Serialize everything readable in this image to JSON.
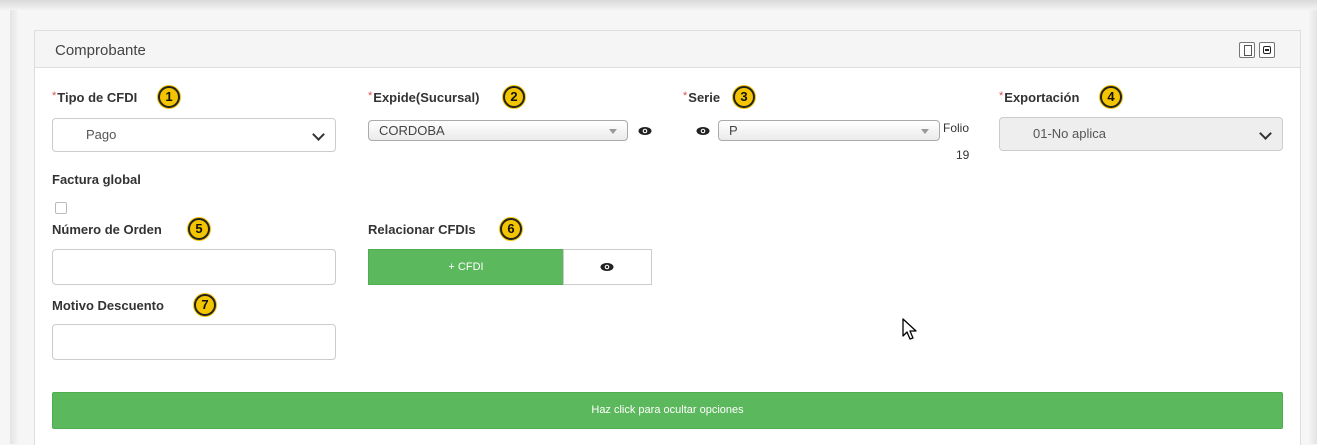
{
  "panel": {
    "title": "Comprobante"
  },
  "fields": {
    "tipo_cfdi": {
      "required_mark": "*",
      "label": "Tipo de CFDI",
      "badge": "1",
      "value": "Pago"
    },
    "expide": {
      "required_mark": "*",
      "label": "Expide(Sucursal)",
      "badge": "2",
      "value": "CORDOBA"
    },
    "serie": {
      "required_mark": "*",
      "label": "Serie",
      "badge": "3",
      "value": "P"
    },
    "folio": {
      "label": "Folio",
      "value": "19"
    },
    "exportacion": {
      "required_mark": "*",
      "label": "Exportación",
      "badge": "4",
      "value": "01-No aplica"
    },
    "factura_global": {
      "label": "Factura global",
      "checked": false
    },
    "numero_orden": {
      "label": "Número de Orden",
      "badge": "5",
      "value": ""
    },
    "relacionar": {
      "label": "Relacionar CFDIs",
      "badge": "6",
      "button": "+ CFDI"
    },
    "motivo_descuento": {
      "label": "Motivo Descuento",
      "badge": "7",
      "value": ""
    }
  },
  "toggle_button": {
    "label": "Haz click para ocultar opciones"
  },
  "colors": {
    "green": "#5cb85c",
    "badge": "#f3c400",
    "required": "#d9534f"
  },
  "icons": [
    "document-icon",
    "minimize-icon",
    "eye-icon",
    "chevron-down-icon",
    "cursor-icon"
  ]
}
